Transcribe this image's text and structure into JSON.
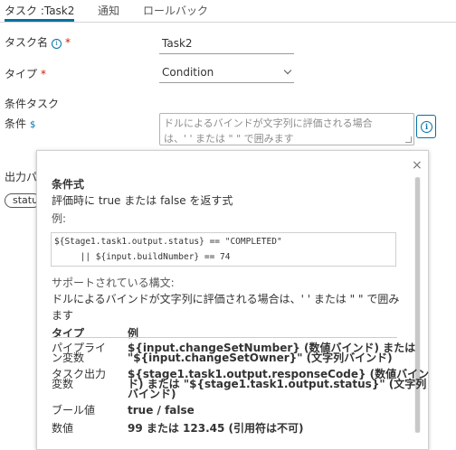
{
  "tabs": [
    {
      "label": "タスク :Task2",
      "active": true
    },
    {
      "label": "通知",
      "active": false
    },
    {
      "label": "ロールバック",
      "active": false
    }
  ],
  "form": {
    "task_name_label": "タスク名",
    "task_name_value": "Task2",
    "type_label": "タイプ",
    "type_value": "Condition",
    "condition_task_heading": "条件タスク",
    "condition_label": "条件",
    "condition_placeholder_line1": "ドルによるバインドが文字列に評価される場合",
    "condition_placeholder_line2": "は、' ' または \" \" で囲みます",
    "output_label": "出力パ",
    "output_chip": "statu",
    "required_mark": "*"
  },
  "icons": {
    "info": "i",
    "dollar": "$",
    "close": "×"
  },
  "popover": {
    "title": "条件式",
    "desc_line": "評価時に true または false を返す式",
    "example_label": "例:",
    "code_line1": "${Stage1.task1.output.status} == \"COMPLETED\"",
    "code_line2": "     || ${input.buildNumber} == 74",
    "syntax_label": "サポートされている構文:",
    "syntax_note_line1": "ドルによるバインドが文字列に評価される場合は、' ' または \" \" で囲み",
    "syntax_note_line2": "ます",
    "table": {
      "col_type": "タイプ",
      "col_example": "例",
      "rows": [
        {
          "type_l1": "パイプライ",
          "type_l2": "ン変数",
          "ex_l1": "${input.changeSetNumber} (数値バインド) または",
          "ex_l2": "\"${input.changeSetOwner}\" (文字列バインド)"
        },
        {
          "type_l1": "タスク出力",
          "type_l2": "変数",
          "ex_l1": "${stage1.task1.output.responseCode} (数値バイン",
          "ex_l2": "ド) または \"${stage1.task1.output.status}\" (文字列",
          "ex_l3": "バインド)"
        },
        {
          "type_l1": "ブール値",
          "ex_l1": "true / false"
        },
        {
          "type_l1": "数値",
          "ex_l1": "99 または 123.45 (引用符は不可)"
        }
      ]
    }
  },
  "colors": {
    "accent": "#0072a3",
    "required": "#c92100",
    "text": "#333333"
  }
}
